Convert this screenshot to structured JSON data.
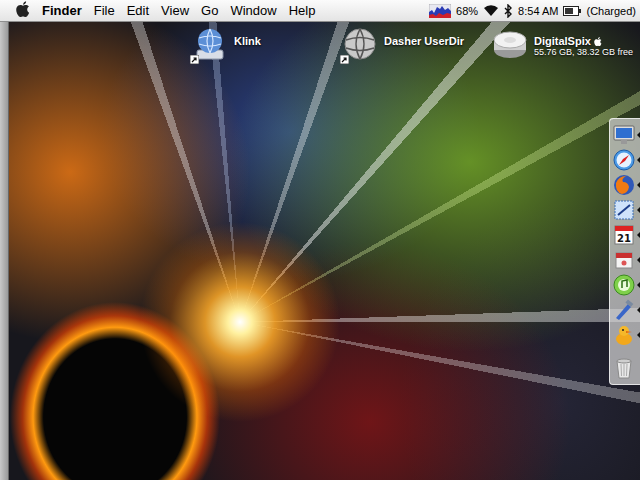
{
  "menu_bar": {
    "app_name": "Finder",
    "menus": [
      "File",
      "Edit",
      "View",
      "Go",
      "Window",
      "Help"
    ],
    "status": {
      "battery_percent": "68%",
      "time": "8:54 AM",
      "charge_state": "(Charged)",
      "battery_level": 0.68
    }
  },
  "desktop_icons": [
    {
      "name": "Klink",
      "kind": "server",
      "alias": true
    },
    {
      "name": "Dasher UserDir",
      "kind": "globe",
      "alias": true
    },
    {
      "name": "DigitalSpix",
      "kind": "drive",
      "alias": false,
      "info": "55.76 GB, 38.32 GB free"
    }
  ],
  "dock": {
    "items": [
      {
        "kind": "monitor",
        "running": true
      },
      {
        "kind": "compass",
        "running": true
      },
      {
        "kind": "firefox",
        "running": true
      },
      {
        "kind": "mail",
        "running": true
      },
      {
        "kind": "calendar",
        "text": "21",
        "running": true
      },
      {
        "kind": "notes",
        "running": true
      },
      {
        "kind": "itunes",
        "running": true
      },
      {
        "kind": "tools",
        "running": true
      },
      {
        "kind": "duck",
        "running": true
      },
      {
        "kind": "trash",
        "running": false
      }
    ]
  }
}
